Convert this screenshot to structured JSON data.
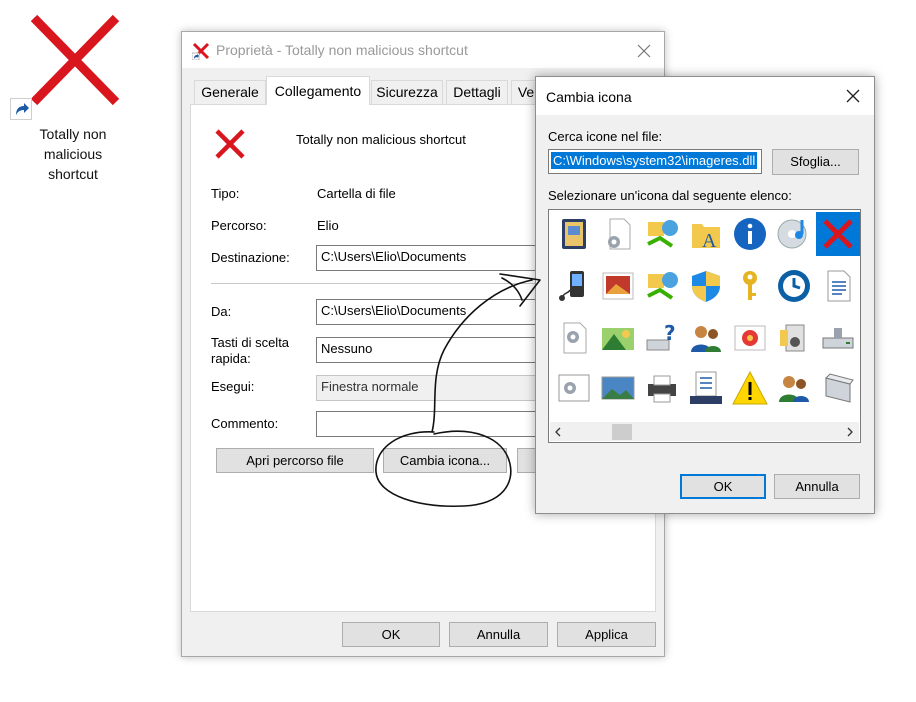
{
  "desktop": {
    "shortcut_label": "Totally non\nmalicious\nshortcut",
    "icon": "red-x-icon",
    "overlay_icon": "shortcut-arrow-icon"
  },
  "properties": {
    "title": "Proprietà - Totally non malicious shortcut",
    "tabs": [
      "Generale",
      "Collegamento",
      "Sicurezza",
      "Dettagli",
      "Ve"
    ],
    "active_tab": "Collegamento",
    "shortcut_name": "Totally non malicious shortcut",
    "tipo_label": "Tipo:",
    "tipo_value": "Cartella di file",
    "percorso_label": "Percorso:",
    "percorso_value": "Elio",
    "destinazione_label": "Destinazione:",
    "destinazione_value": "C:\\Users\\Elio\\Documents",
    "da_label": "Da:",
    "da_value": "C:\\Users\\Elio\\Documents",
    "tasti_label": "Tasti di scelta\nrapida:",
    "tasti_value": "Nessuno",
    "esegui_label": "Esegui:",
    "esegui_value": "Finestra normale",
    "commento_label": "Commento:",
    "commento_value": "",
    "open_path_button": "Apri percorso file",
    "change_icon_button": "Cambia icona...",
    "ok_button": "OK",
    "cancel_button": "Annulla",
    "apply_button": "Applica"
  },
  "change_icon_dialog": {
    "title": "Cambia icona",
    "search_label": "Cerca icone nel file:",
    "file_path": "C:\\Windows\\system32\\imageres.dll",
    "browse_button": "Sfoglia...",
    "list_label": "Selezionare un'icona dal seguente elenco:",
    "icons": [
      "contacts-book-icon",
      "settings-document-icon",
      "network-users-icon",
      "fonts-folder-icon",
      "info-icon",
      "music-cd-icon",
      "red-x-icon",
      "media-player-icon",
      "photo-gallery-icon",
      "network-share-icon",
      "uac-shield-icon",
      "key-icon",
      "sync-clock-icon",
      "text-document-icon",
      "gear-document-icon",
      "landscape-icon",
      "network-help-icon",
      "users-icon",
      "picture-frame-icon",
      "media-device-icon",
      "drive-icon",
      "settings-window-icon",
      "picture-icon",
      "printer-icon",
      "checklist-device-icon",
      "warning-icon",
      "user-group-icon",
      "removable-drive-icon"
    ],
    "selected_icon": "red-x-icon",
    "ok_button": "OK",
    "cancel_button": "Annulla"
  },
  "colors": {
    "accent": "#0078d7",
    "red_x": "#d9161e",
    "window_bg": "#f0f0f0"
  }
}
